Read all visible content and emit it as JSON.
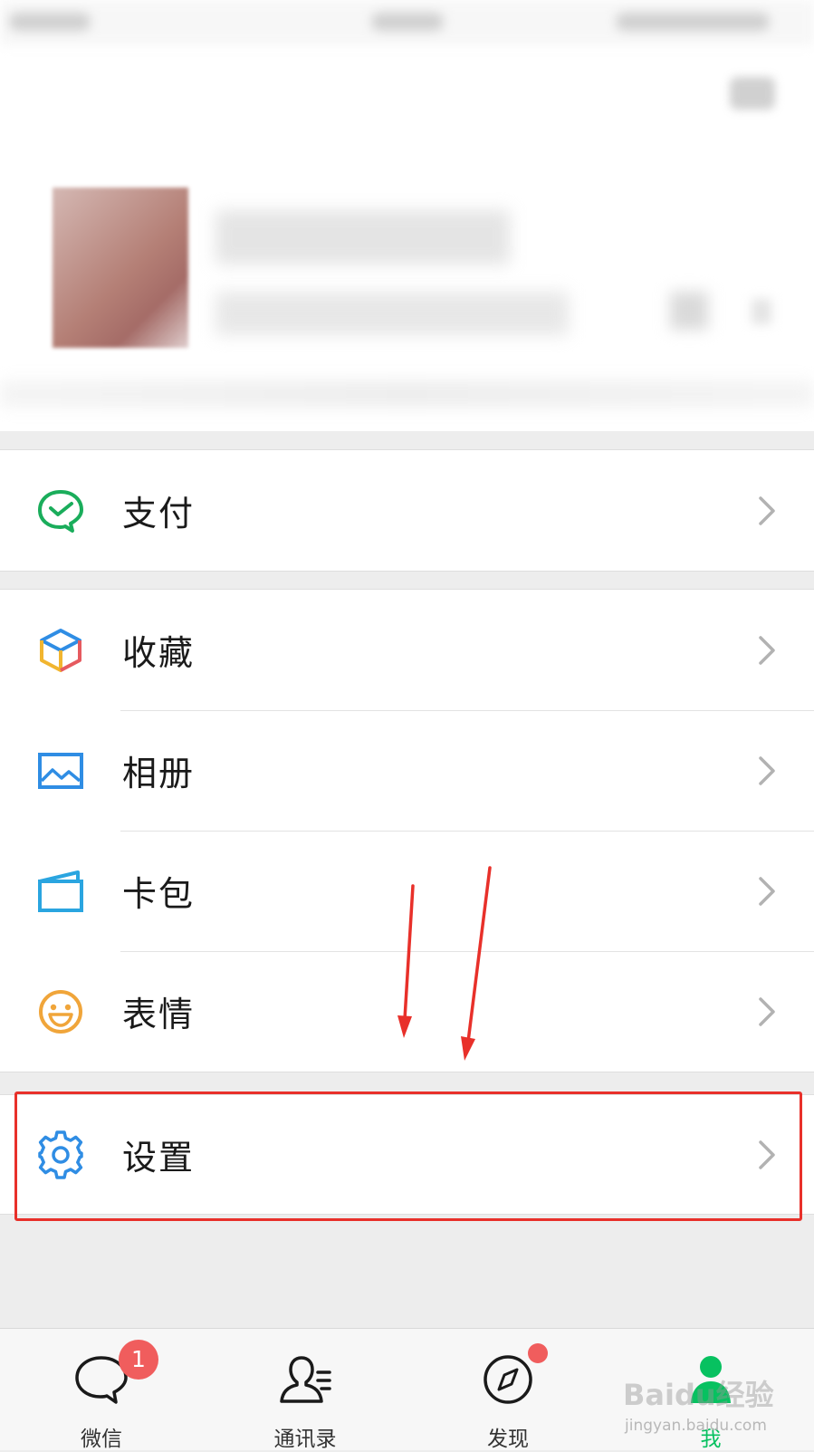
{
  "colors": {
    "accent_green": "#07c160",
    "badge_red": "#f05d5d",
    "highlight_red": "#e8302a"
  },
  "menu": {
    "pay": {
      "label": "支付",
      "icon": "wechat-pay-icon"
    },
    "favorites": {
      "label": "收藏",
      "icon": "favorites-cube-icon"
    },
    "album": {
      "label": "相册",
      "icon": "album-picture-icon"
    },
    "cards": {
      "label": "卡包",
      "icon": "card-wallet-icon"
    },
    "stickers": {
      "label": "表情",
      "icon": "smiley-icon"
    },
    "settings": {
      "label": "设置",
      "icon": "gear-icon"
    }
  },
  "tab_bar": {
    "chats": {
      "label": "微信",
      "badge": "1",
      "icon": "chat-bubble-icon"
    },
    "contacts": {
      "label": "通讯录",
      "icon": "contacts-icon"
    },
    "discover": {
      "label": "发现",
      "icon": "compass-icon"
    },
    "me": {
      "label": "我",
      "icon": "person-icon",
      "active": true
    }
  },
  "watermark": {
    "brand": "Baidu经验",
    "url": "jingyan.baidu.com"
  }
}
